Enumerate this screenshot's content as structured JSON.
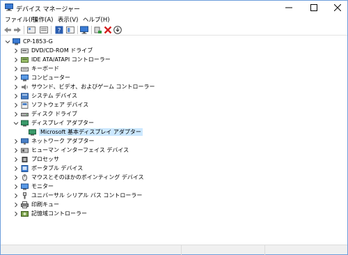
{
  "window": {
    "title": "デバイス マネージャー"
  },
  "menu": [
    {
      "label": "ファイル(F)"
    },
    {
      "label": "操作(A)"
    },
    {
      "label": "表示(V)"
    },
    {
      "label": "ヘルプ(H)"
    }
  ],
  "toolbar": {
    "icons": [
      "back-arrow-icon",
      "forward-arrow-icon",
      "properties-icon",
      "update-icon",
      "help-icon",
      "view-icon",
      "monitor-icon",
      "enable-device-icon",
      "uninstall-x-icon",
      "scan-icon"
    ]
  },
  "tree": {
    "root": "CP-1853-G",
    "items": [
      {
        "label": "DVD/CD-ROM ドライブ",
        "icon": "dvd-icon",
        "expanded": false
      },
      {
        "label": "IDE ATA/ATAPI コントローラー",
        "icon": "ide-icon",
        "expanded": false
      },
      {
        "label": "キーボード",
        "icon": "keyboard-icon",
        "expanded": false
      },
      {
        "label": "コンピューター",
        "icon": "computer-icon",
        "expanded": false
      },
      {
        "label": "サウンド、ビデオ、およびゲーム コントローラー",
        "icon": "sound-icon",
        "expanded": false
      },
      {
        "label": "システム デバイス",
        "icon": "system-icon",
        "expanded": false
      },
      {
        "label": "ソフトウェア デバイス",
        "icon": "software-icon",
        "expanded": false
      },
      {
        "label": "ディスク ドライブ",
        "icon": "disk-icon",
        "expanded": false
      },
      {
        "label": "ディスプレイ アダプター",
        "icon": "display-icon",
        "expanded": true,
        "children": [
          {
            "label": "Microsoft 基本ディスプレイ アダプター",
            "icon": "display-icon"
          }
        ]
      },
      {
        "label": "ネットワーク アダプター",
        "icon": "network-icon",
        "expanded": false
      },
      {
        "label": "ヒューマン インターフェイス デバイス",
        "icon": "hid-icon",
        "expanded": false
      },
      {
        "label": "プロセッサ",
        "icon": "processor-icon",
        "expanded": false
      },
      {
        "label": "ポータブル デバイス",
        "icon": "portable-icon",
        "expanded": false
      },
      {
        "label": "マウスとそのほかのポインティング デバイス",
        "icon": "mouse-icon",
        "expanded": false
      },
      {
        "label": "モニター",
        "icon": "monitor-icon",
        "expanded": false
      },
      {
        "label": "ユニバーサル シリアル バス コントローラー",
        "icon": "usb-icon",
        "expanded": false
      },
      {
        "label": "印刷キュー",
        "icon": "printer-icon",
        "expanded": false
      },
      {
        "label": "記憶域コントローラー",
        "icon": "storage-icon",
        "expanded": false
      }
    ]
  },
  "colors": {
    "accent": "#0078d7",
    "selection": "#cce8ff",
    "border": "#6d9ddb"
  }
}
